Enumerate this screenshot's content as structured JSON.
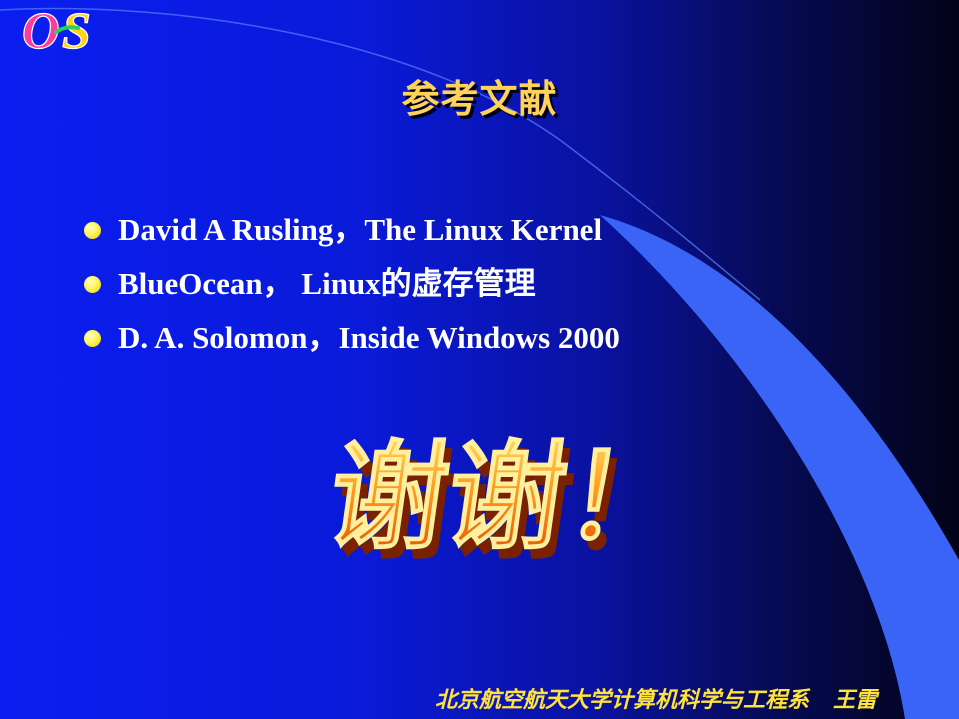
{
  "slide": {
    "logo_text": "OS",
    "title": "参考文献",
    "references": [
      "David A Rusling，The Linux Kernel",
      "BlueOcean， Linux的虚存管理",
      "D. A. Solomon，Inside Windows 2000"
    ],
    "thanks_text": "谢谢！",
    "footer": {
      "institution": "北京航空航天大学计算机科学与工程系",
      "author": "王雷"
    }
  },
  "colors": {
    "background": "#0a1ef0",
    "title": "#ffd25a",
    "bullet": "#fff45a",
    "footer": "#ffe23a",
    "accent_band": "#3a64ff"
  }
}
